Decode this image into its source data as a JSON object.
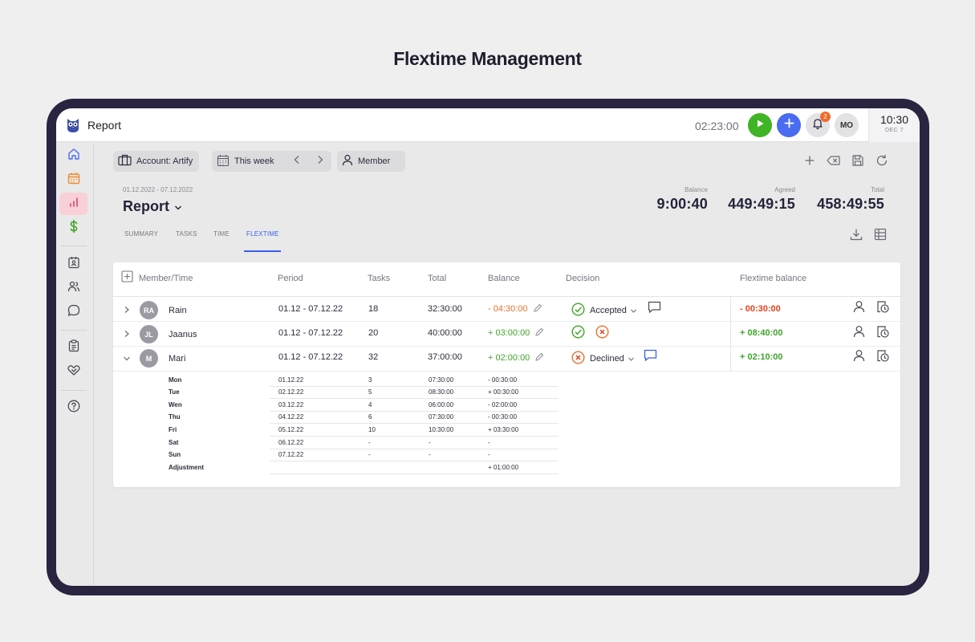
{
  "page_heading": "Flextime Management",
  "app": {
    "title": "Report",
    "timer": "02:23:00",
    "notifications_count": "2",
    "user_initials": "MO",
    "clock_time": "10:30",
    "clock_date": "DEC 7"
  },
  "toolbar": {
    "account_label": "Account: Artify",
    "period_label": "This week",
    "member_label": "Member"
  },
  "report": {
    "date_range": "01.12.2022 - 07.12.2022",
    "title": "Report",
    "stats": [
      {
        "label": "Balance",
        "value": "9:00:40"
      },
      {
        "label": "Agreed",
        "value": "449:49:15"
      },
      {
        "label": "Total",
        "value": "458:49:55"
      }
    ],
    "tabs": [
      "SUMMARY",
      "TASKS",
      "TIME",
      "FLEXTIME"
    ],
    "active_tab": "FLEXTIME"
  },
  "table": {
    "columns": [
      "Member/Time",
      "Period",
      "Tasks",
      "Total",
      "Balance",
      "Decision",
      "Flextime balance"
    ],
    "rows": [
      {
        "initials": "RA",
        "name": "Rain",
        "period": "01.12 - 07.12.22",
        "tasks": "18",
        "total": "32:30:00",
        "balance": "- 04:30:00",
        "decision": "Accepted",
        "flextime": "- 00:30:00"
      },
      {
        "initials": "JL",
        "name": "Jaanus",
        "period": "01.12 - 07.12.22",
        "tasks": "20",
        "total": "40:00:00",
        "balance": "+ 03:00:00",
        "decision": "",
        "flextime": "+ 08:40:00"
      },
      {
        "initials": "M",
        "name": "Mari",
        "period": "01.12 - 07.12.22",
        "tasks": "32",
        "total": "37:00:00",
        "balance": "+ 02:00:00",
        "decision": "Declined",
        "flextime": "+ 02:10:00"
      }
    ],
    "details": [
      {
        "day": "Mon",
        "date": "01.12.22",
        "tasks": "3",
        "total": "07:30:00",
        "balance": "- 00:30:00"
      },
      {
        "day": "Tue",
        "date": "02.12.22",
        "tasks": "5",
        "total": "08:30:00",
        "balance": "+ 00:30:00"
      },
      {
        "day": "Wen",
        "date": "03.12.22",
        "tasks": "4",
        "total": "06:00:00",
        "balance": "- 02:00:00"
      },
      {
        "day": "Thu",
        "date": "04.12.22",
        "tasks": "6",
        "total": "07:30:00",
        "balance": "- 00:30:00"
      },
      {
        "day": "Fri",
        "date": "05.12.22",
        "tasks": "10",
        "total": "10:30:00",
        "balance": "+ 03:30:00"
      },
      {
        "day": "Sat",
        "date": "06.12.22",
        "tasks": "-",
        "total": "-",
        "balance": "-"
      },
      {
        "day": "Sun",
        "date": "07.12.22",
        "tasks": "-",
        "total": "-",
        "balance": "-"
      },
      {
        "day": "Adjustment",
        "date": "",
        "tasks": "",
        "total": "",
        "balance": "+ 01:00:00"
      }
    ]
  },
  "colors": {
    "accent": "#3b5ef0",
    "positive": "#3fa52a",
    "negative": "#e8722e",
    "play": "#3fb424",
    "device_frame": "#2a2440"
  },
  "icons": [
    "owl-logo-icon",
    "home-icon",
    "calendar-icon",
    "chart-icon",
    "dollar-icon",
    "id-badge-icon",
    "users-icon",
    "chat-icon",
    "clipboard-icon",
    "handshake-icon",
    "help-icon",
    "play-icon",
    "plus-icon",
    "bell-icon",
    "briefcase-icon",
    "calendar-grid-icon",
    "chevron-left-icon",
    "chevron-right-icon",
    "person-icon",
    "add-icon",
    "clear-icon",
    "save-icon",
    "refresh-icon",
    "download-icon",
    "table-icon",
    "check-circle-icon",
    "x-circle-icon",
    "comment-icon",
    "pencil-icon",
    "person-outline-icon",
    "timesheet-icon"
  ]
}
